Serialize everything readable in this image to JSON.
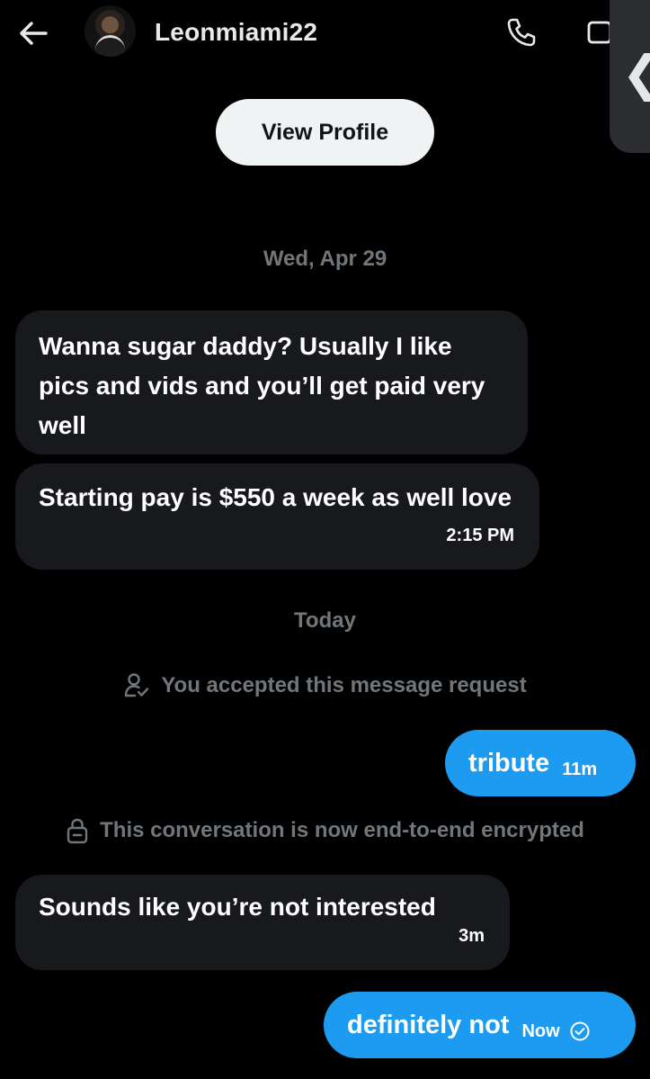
{
  "header": {
    "username": "Leonmiami22",
    "back_icon": "arrow-left-icon",
    "call_icon": "phone-icon",
    "video_icon": "video-icon",
    "side_handle_glyph": "❮"
  },
  "profile": {
    "view_profile_label": "View Profile"
  },
  "messages": {
    "date_1": "Wed, Apr 29",
    "m1_text": "Wanna sugar daddy? Usually I like pics and vids and you’ll get paid very well",
    "m2_text": "Starting pay is $550 a week as well love",
    "m2_time": "2:15 PM",
    "date_2": "Today",
    "accepted_note": "You accepted this message request",
    "m3_text": "tribute",
    "m3_time": "11m",
    "encrypted_note": "This conversation is now end-to-end encrypted",
    "m4_text": "Sounds like you’re not interested",
    "m4_time": "3m",
    "m5_text": "definitely not",
    "m5_time": "Now",
    "m5_status_icon": "check-circle-icon"
  },
  "colors": {
    "background": "#000000",
    "incoming_bubble": "#17191c",
    "outgoing_bubble": "#1d9bf0",
    "muted_text": "#71767b",
    "view_profile_bg": "#eff3f4"
  }
}
